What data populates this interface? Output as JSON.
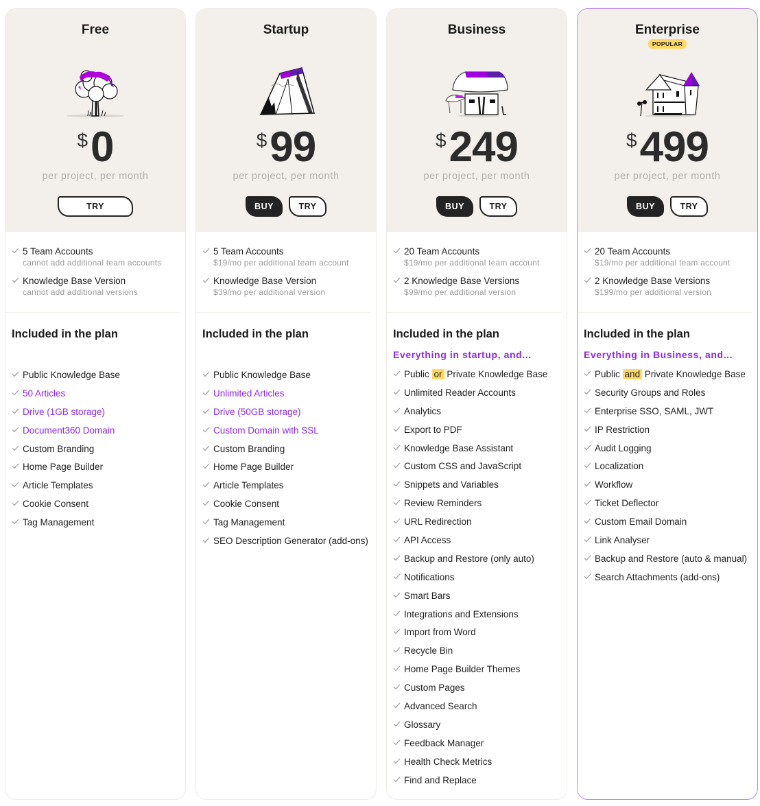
{
  "colors": {
    "accent": "#8a2be2",
    "highlight": "#ffd966",
    "header_bg": "#f3f0eb",
    "popular_border": "#b88af0",
    "dark_button": "#232323"
  },
  "plans": [
    {
      "name": "Free",
      "illustration": "tree-illustration",
      "currency": "$",
      "price": "0",
      "period": "per project, per month",
      "buttons": {
        "try": "TRY"
      },
      "accounts": [
        {
          "title": "5 Team Accounts",
          "sub": "cannot add additional team accounts"
        },
        {
          "title": "Knowledge Base Version",
          "sub": "cannot add additional versions"
        }
      ],
      "included_title": "Included in the plan",
      "features": [
        {
          "text": "Public Knowledge Base",
          "accent": false
        },
        {
          "text": "50 Articles",
          "accent": true
        },
        {
          "text": "Drive (1GB storage)",
          "accent": true
        },
        {
          "text": "Document360 Domain",
          "accent": true
        },
        {
          "text": "Custom Branding",
          "accent": false
        },
        {
          "text": "Home Page Builder",
          "accent": false
        },
        {
          "text": "Article Templates",
          "accent": false
        },
        {
          "text": "Cookie Consent",
          "accent": false
        },
        {
          "text": "Tag Management",
          "accent": false
        }
      ]
    },
    {
      "name": "Startup",
      "illustration": "tent-illustration",
      "currency": "$",
      "price": "99",
      "period": "per project, per month",
      "buttons": {
        "buy": "BUY",
        "try": "TRY"
      },
      "accounts": [
        {
          "title": "5 Team Accounts",
          "sub": "$19/mo per additional team account"
        },
        {
          "title": "Knowledge Base Version",
          "sub": "$39/mo per additional version"
        }
      ],
      "included_title": "Included in the plan",
      "features": [
        {
          "text": "Public Knowledge Base",
          "accent": false
        },
        {
          "text": "Unlimited Articles",
          "accent": true
        },
        {
          "text": "Drive (50GB storage)",
          "accent": true
        },
        {
          "text": "Custom Domain with SSL",
          "accent": true
        },
        {
          "text": "Custom Branding",
          "accent": false
        },
        {
          "text": "Home Page Builder",
          "accent": false
        },
        {
          "text": "Article Templates",
          "accent": false
        },
        {
          "text": "Cookie Consent",
          "accent": false
        },
        {
          "text": "Tag Management",
          "accent": false
        },
        {
          "text": "SEO Description Generator (add-ons)",
          "accent": false
        }
      ]
    },
    {
      "name": "Business",
      "illustration": "hut-illustration",
      "currency": "$",
      "price": "249",
      "period": "per project, per month",
      "buttons": {
        "buy": "BUY",
        "try": "TRY"
      },
      "accounts": [
        {
          "title": "20 Team Accounts",
          "sub": "$19/mo per additional team account"
        },
        {
          "title": "2 Knowledge Base Versions",
          "sub": "$99/mo per additional version"
        }
      ],
      "included_title": "Included in the plan",
      "included_sub": "Everything in startup, and...",
      "first_feature": {
        "pre": "Public",
        "hl": "or",
        "post": "Private Knowledge Base"
      },
      "features": [
        {
          "text": "Unlimited Reader Accounts",
          "accent": false
        },
        {
          "text": "Analytics",
          "accent": false
        },
        {
          "text": "Export to PDF",
          "accent": false
        },
        {
          "text": "Knowledge Base Assistant",
          "accent": false
        },
        {
          "text": "Custom CSS and JavaScript",
          "accent": false
        },
        {
          "text": "Snippets and Variables",
          "accent": false
        },
        {
          "text": "Review Reminders",
          "accent": false
        },
        {
          "text": "URL Redirection",
          "accent": false
        },
        {
          "text": "API Access",
          "accent": false
        },
        {
          "text": "Backup and Restore (only auto)",
          "accent": false
        },
        {
          "text": "Notifications",
          "accent": false
        },
        {
          "text": "Smart Bars",
          "accent": false
        },
        {
          "text": "Integrations and Extensions",
          "accent": false
        },
        {
          "text": "Import from Word",
          "accent": false
        },
        {
          "text": "Recycle Bin",
          "accent": false
        },
        {
          "text": "Home Page Builder Themes",
          "accent": false
        },
        {
          "text": "Custom Pages",
          "accent": false
        },
        {
          "text": "Advanced Search",
          "accent": false
        },
        {
          "text": "Glossary",
          "accent": false
        },
        {
          "text": "Feedback Manager",
          "accent": false
        },
        {
          "text": "Health Check Metrics",
          "accent": false
        },
        {
          "text": "Find and Replace",
          "accent": false
        }
      ]
    },
    {
      "name": "Enterprise",
      "badge": "POPULAR",
      "illustration": "mansion-illustration",
      "currency": "$",
      "price": "499",
      "period": "per project, per month",
      "buttons": {
        "buy": "BUY",
        "try": "TRY"
      },
      "accounts": [
        {
          "title": "20 Team Accounts",
          "sub": "$19/mo per additional team account"
        },
        {
          "title": "2 Knowledge Base Versions",
          "sub": "$199/mo per additional version"
        }
      ],
      "included_title": "Included in the plan",
      "included_sub": "Everything in Business, and...",
      "first_feature": {
        "pre": "Public",
        "hl": "and",
        "post": "Private Knowledge Base"
      },
      "features": [
        {
          "text": "Security Groups and Roles",
          "accent": false
        },
        {
          "text": "Enterprise SSO, SAML, JWT",
          "accent": false
        },
        {
          "text": "IP Restriction",
          "accent": false
        },
        {
          "text": "Audit Logging",
          "accent": false
        },
        {
          "text": "Localization",
          "accent": false
        },
        {
          "text": "Workflow",
          "accent": false
        },
        {
          "text": "Ticket Deflector",
          "accent": false
        },
        {
          "text": "Custom Email Domain",
          "accent": false
        },
        {
          "text": "Link Analyser",
          "accent": false
        },
        {
          "text": "Backup and Restore (auto & manual)",
          "accent": false
        },
        {
          "text": "Search Attachments (add-ons)",
          "accent": false
        }
      ]
    }
  ]
}
